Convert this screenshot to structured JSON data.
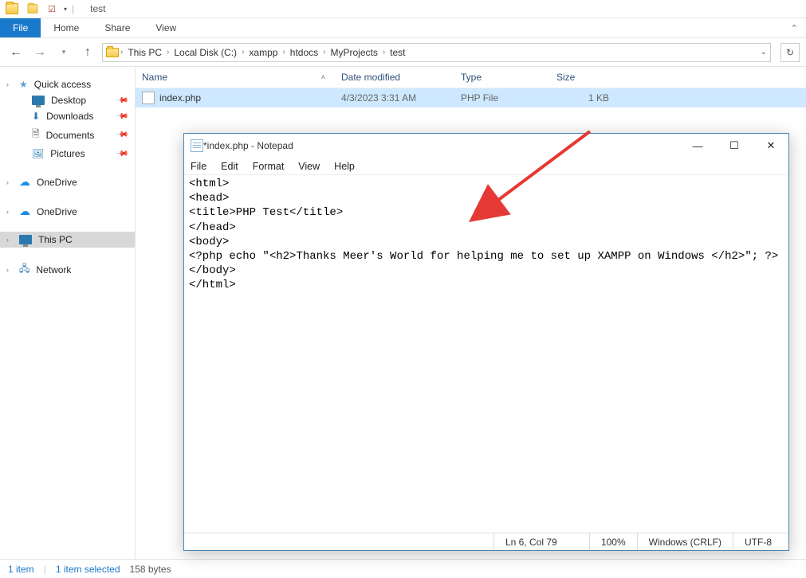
{
  "titlebar": {
    "title": "test"
  },
  "ribbon": {
    "file": "File",
    "home": "Home",
    "share": "Share",
    "view": "View"
  },
  "breadcrumb": {
    "items": [
      "This PC",
      "Local Disk (C:)",
      "xampp",
      "htdocs",
      "MyProjects",
      "test"
    ]
  },
  "sidebar": {
    "quick_access": "Quick access",
    "desktop": "Desktop",
    "downloads": "Downloads",
    "documents": "Documents",
    "pictures": "Pictures",
    "onedrive1": "OneDrive",
    "onedrive2": "OneDrive",
    "this_pc": "This PC",
    "network": "Network"
  },
  "columns": {
    "name": "Name",
    "date": "Date modified",
    "type": "Type",
    "size": "Size"
  },
  "files": [
    {
      "name": "index.php",
      "date": "4/3/2023 3:31 AM",
      "type": "PHP File",
      "size": "1 KB"
    }
  ],
  "statusbar": {
    "count": "1 item",
    "selected": "1 item selected",
    "bytes": "158 bytes"
  },
  "notepad": {
    "title": "*index.php - Notepad",
    "menus": {
      "file": "File",
      "edit": "Edit",
      "format": "Format",
      "view": "View",
      "help": "Help"
    },
    "content": "<html>\n<head>\n<title>PHP Test</title>\n</head>\n<body>\n<?php echo \"<h2>Thanks Meer's World for helping me to set up XAMPP on Windows </h2>\"; ?>\n</body>\n</html>",
    "status": {
      "pos": "Ln 6, Col 79",
      "zoom": "100%",
      "eol": "Windows (CRLF)",
      "enc": "UTF-8"
    }
  }
}
